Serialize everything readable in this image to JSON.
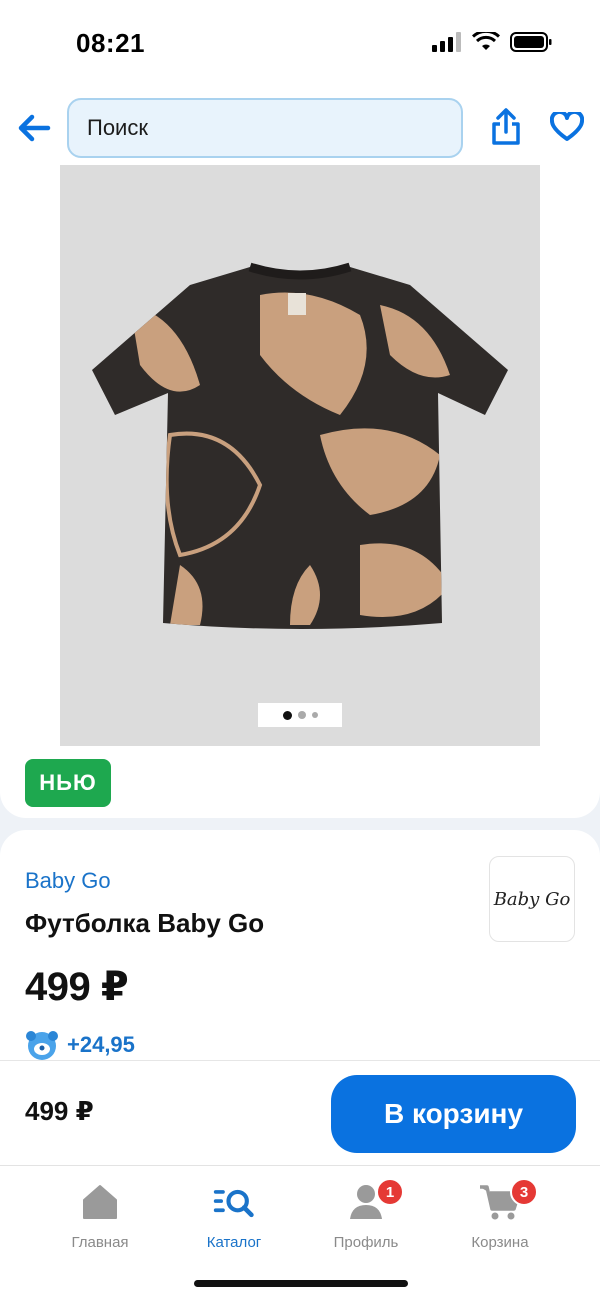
{
  "status": {
    "time": "08:21"
  },
  "search": {
    "placeholder": "Поиск"
  },
  "badge": {
    "label": "НЬЮ"
  },
  "product": {
    "brand": "Baby Go",
    "title": "Футболка Baby Go",
    "price": "499 ₽",
    "bonus": "+24,95",
    "brand_logo_text": "Baby Go"
  },
  "buy_bar": {
    "price": "499 ₽",
    "button": "В корзину"
  },
  "tabs": [
    {
      "label": "Главная",
      "icon": "home-icon"
    },
    {
      "label": "Каталог",
      "icon": "catalog-search-icon"
    },
    {
      "label": "Профиль",
      "icon": "profile-icon",
      "badge": "1"
    },
    {
      "label": "Корзина",
      "icon": "cart-icon",
      "badge": "3"
    }
  ],
  "gallery": {
    "current": 1,
    "total": 3
  },
  "colors": {
    "accent": "#0a72e0",
    "link": "#1a73c9",
    "new_badge": "#1ea84f",
    "notification": "#e53935"
  }
}
